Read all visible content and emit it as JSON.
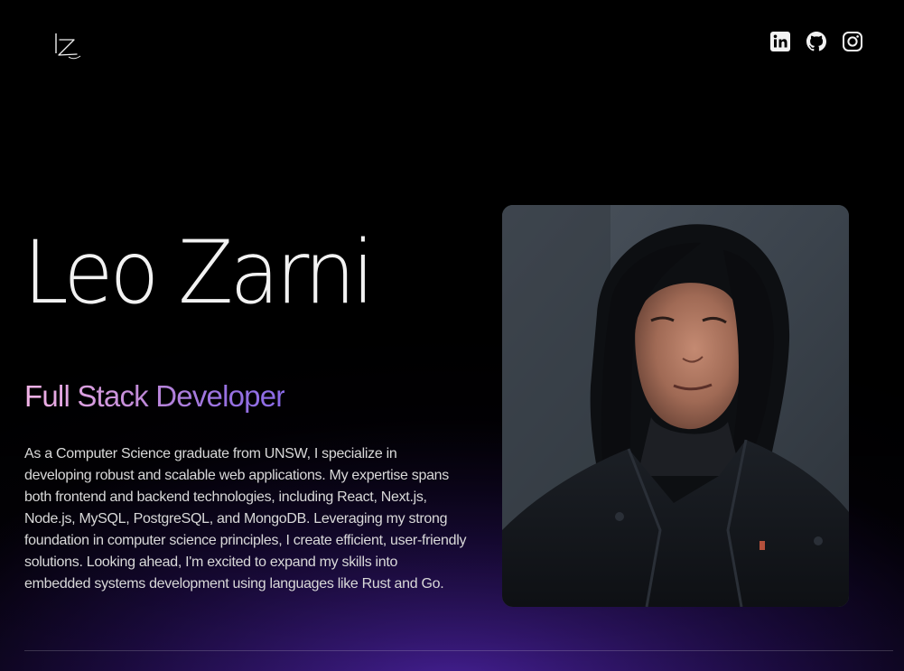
{
  "header": {
    "logo_text": "LZ",
    "social": [
      {
        "icon": "linkedin-icon",
        "label": "LinkedIn"
      },
      {
        "icon": "github-icon",
        "label": "GitHub"
      },
      {
        "icon": "instagram-icon",
        "label": "Instagram"
      }
    ]
  },
  "hero": {
    "name": "Leo Zarni",
    "role": "Full Stack Developer",
    "bio": "As a Computer Science graduate from UNSW, I specialize in developing robust and scalable web applications. My expertise spans both frontend and backend technologies, including React, Next.js, Node.js, MySQL, PostgreSQL, and MongoDB. Leveraging my strong foundation in computer science principles, I create efficient, user-friendly solutions. Looking ahead, I'm excited to expand my skills into embedded systems development using languages like Rust and Go."
  },
  "colors": {
    "background": "#000000",
    "role_gradient_start": "#f3b3e6",
    "role_gradient_end": "#8a6ae6",
    "glow": "#5828be",
    "text": "#d9d9d9"
  }
}
